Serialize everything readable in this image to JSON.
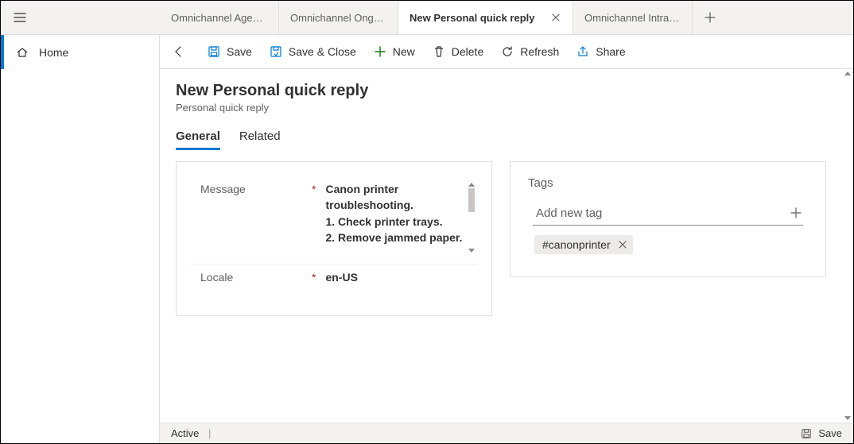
{
  "nav": {
    "home_label": "Home"
  },
  "tabs": {
    "t0": "Omnichannel Age…",
    "t1": "Omnichannel Ong…",
    "t2": "New Personal quick reply",
    "t3": "Omnichannel Intra…"
  },
  "cmdbar": {
    "save": "Save",
    "save_close": "Save & Close",
    "new": "New",
    "delete": "Delete",
    "refresh": "Refresh",
    "share": "Share"
  },
  "page": {
    "title": "New Personal quick reply",
    "subtitle": "Personal quick reply"
  },
  "formtabs": {
    "general": "General",
    "related": "Related"
  },
  "fields": {
    "message_label": "Message",
    "message_value": "Canon printer troubleshooting.\n1. Check printer trays.\n2. Remove jammed paper.",
    "locale_label": "Locale",
    "locale_value": "en-US"
  },
  "tags": {
    "section_title": "Tags",
    "placeholder": "Add new tag",
    "chip0": "#canonprinter"
  },
  "status": {
    "active": "Active",
    "save": "Save"
  }
}
